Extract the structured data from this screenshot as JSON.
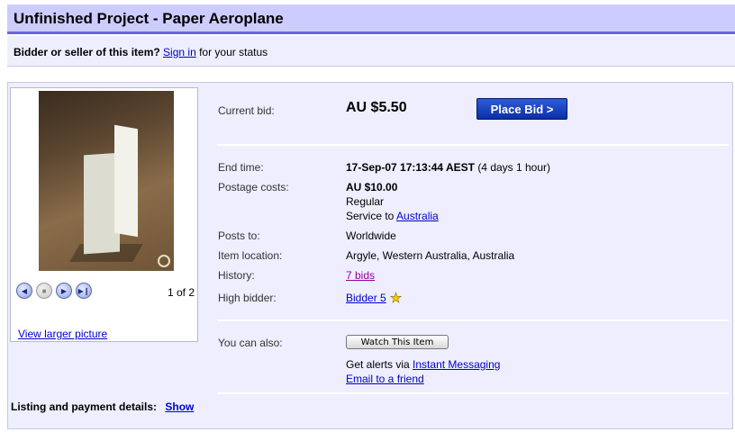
{
  "title": "Unfinished Project - Paper Aeroplane",
  "status": {
    "prefix": "Bidder or seller of this item?",
    "link": "Sign in",
    "suffix": "for your status"
  },
  "picture": {
    "count": "1 of 2",
    "larger_link": "View larger picture",
    "nav": [
      "prev-icon",
      "stop-icon",
      "play-icon",
      "next-icon"
    ]
  },
  "bid": {
    "label": "Current bid:",
    "amount": "AU $5.50",
    "button": "Place Bid >"
  },
  "end_time": {
    "label": "End time:",
    "value": "17-Sep-07 17:13:44 AEST",
    "remaining": "(4 days 1 hour)"
  },
  "postage": {
    "label": "Postage costs:",
    "amount": "AU $10.00",
    "method": "Regular",
    "service_prefix": "Service to",
    "service_link": "Australia"
  },
  "posts_to": {
    "label": "Posts to:",
    "value": "Worldwide"
  },
  "location": {
    "label": "Item location:",
    "value": "Argyle, Western Australia, Australia"
  },
  "history": {
    "label": "History:",
    "value": "7 bids"
  },
  "high_bidder": {
    "label": "High bidder:",
    "value": "Bidder 5",
    "icon": "star-icon"
  },
  "also": {
    "label": "You can also:",
    "watch_button": "Watch This Item",
    "alerts_prefix": "Get alerts via",
    "alerts_link": "Instant Messaging",
    "email_link": "Email to a friend"
  },
  "listing": {
    "label": "Listing and payment details:",
    "link": "Show"
  },
  "colors": {
    "accent": "#6666dd",
    "title_bg": "#ccccff",
    "panel_bg": "#eeeeff",
    "button_bg": "#0b2fa8"
  }
}
